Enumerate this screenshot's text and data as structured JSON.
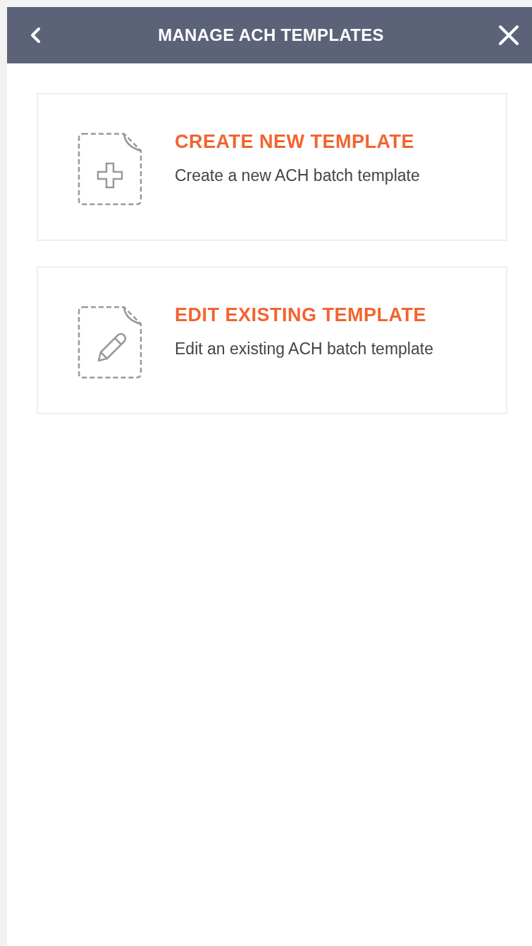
{
  "header": {
    "title": "MANAGE ACH TEMPLATES"
  },
  "options": [
    {
      "kind": "create",
      "title": "CREATE NEW TEMPLATE",
      "description": "Create a new ACH batch template"
    },
    {
      "kind": "edit",
      "title": "EDIT EXISTING TEMPLATE",
      "description": "Edit an existing ACH batch template"
    }
  ]
}
